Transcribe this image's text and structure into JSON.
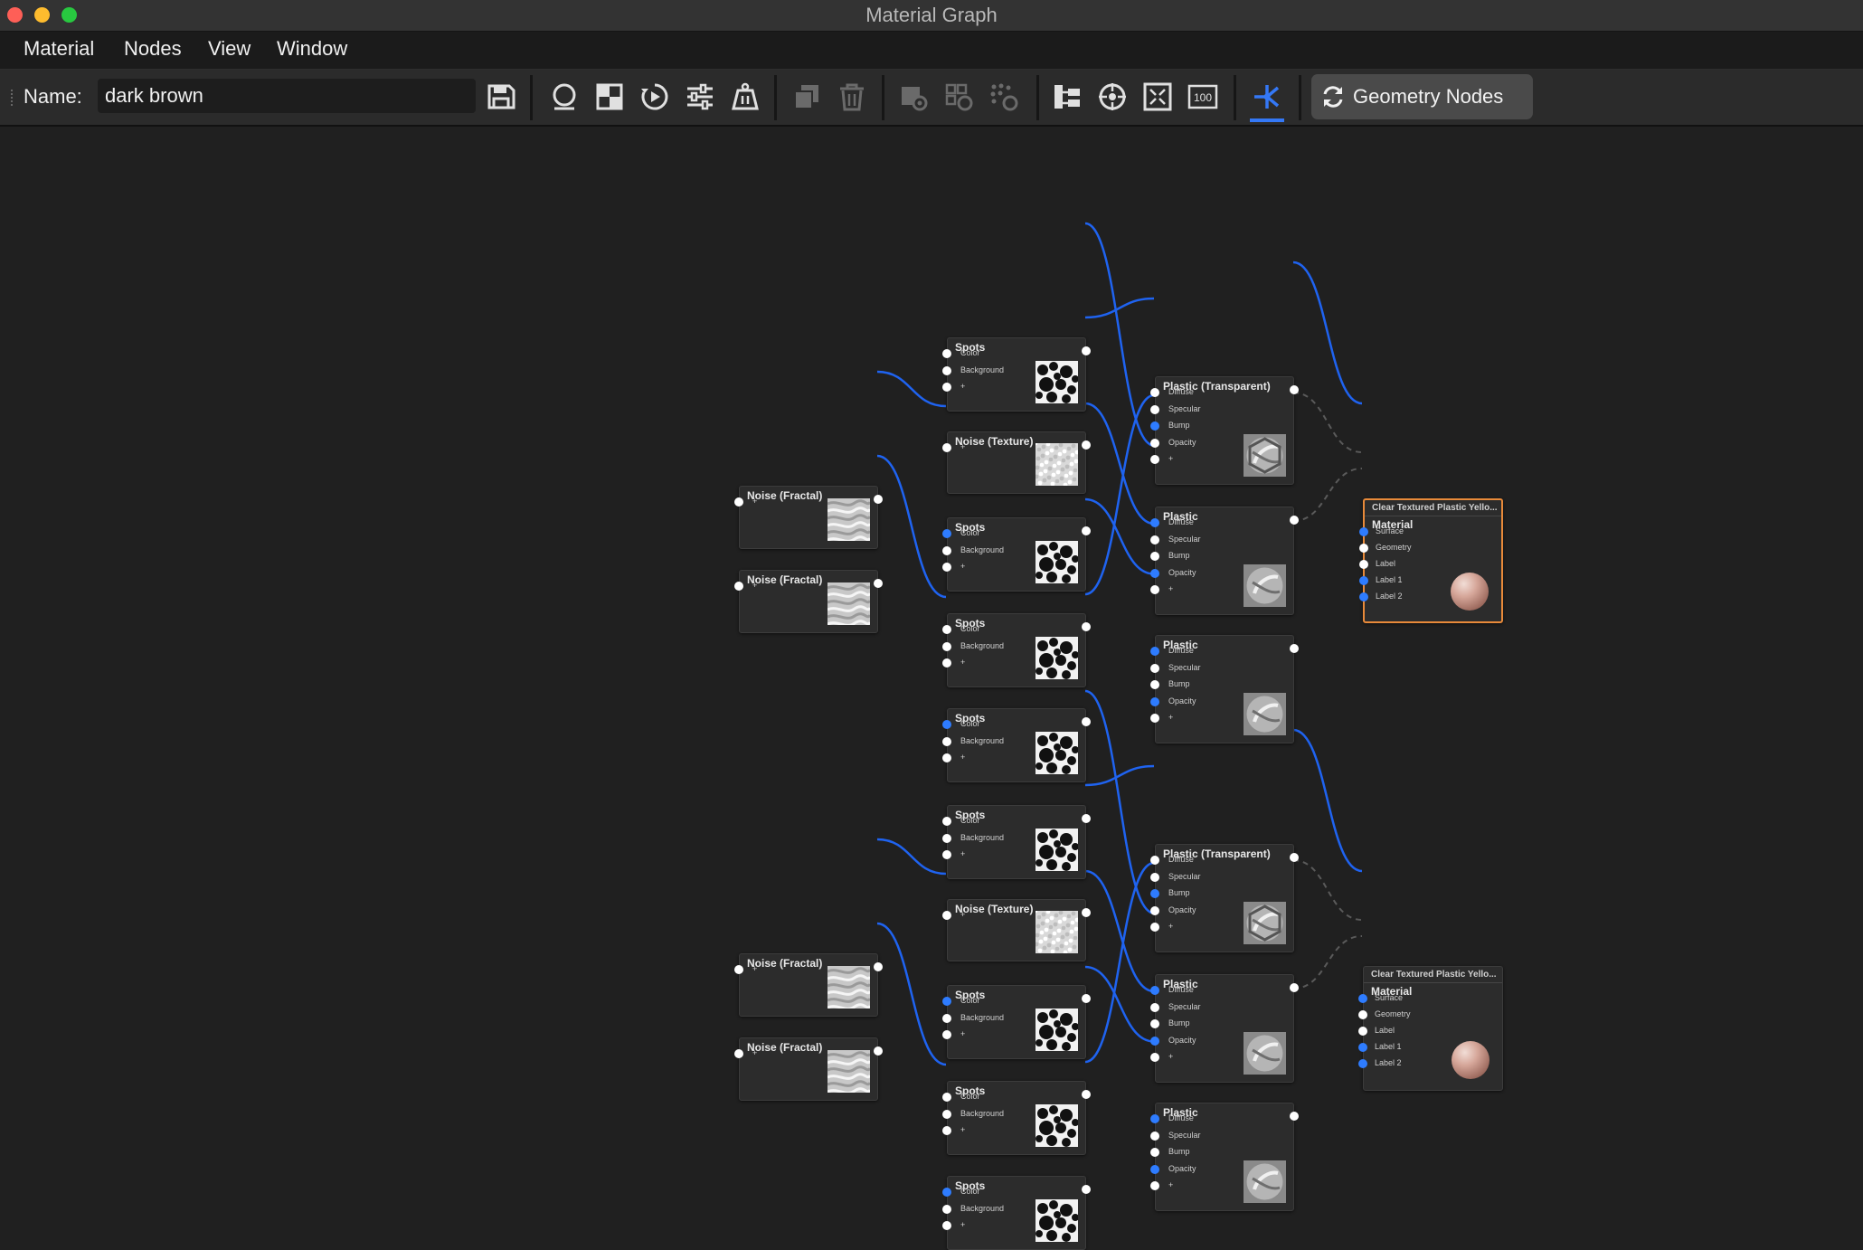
{
  "window": {
    "title": "Material Graph"
  },
  "menu": [
    "Material",
    "Nodes",
    "View",
    "Window"
  ],
  "toolbar": {
    "name_label": "Name:",
    "name_value": "dark brown",
    "geometry_button": "Geometry Nodes",
    "zoom_badge": "100"
  },
  "colors": {
    "accent": "#3478f6",
    "link": "#1f63f0",
    "selected_border": "#e88a3a",
    "canvas": "#202020"
  },
  "nodes": {
    "spots": {
      "title": "Spots",
      "ports": [
        "Color",
        "Background",
        "+"
      ]
    },
    "noise_texture": {
      "title": "Noise (Texture)",
      "ports": [
        "+"
      ]
    },
    "noise_fractal": {
      "title": "Noise (Fractal)",
      "ports": [
        "+"
      ]
    },
    "plastic_transparent": {
      "title": "Plastic (Transparent)",
      "ports": [
        "Diffuse",
        "Specular",
        "Bump",
        "Opacity",
        "+"
      ]
    },
    "plastic": {
      "title": "Plastic",
      "ports": [
        "Diffuse",
        "Specular",
        "Bump",
        "Opacity",
        "+"
      ]
    },
    "material": {
      "header": "Clear Textured Plastic Yello...",
      "title": "Material",
      "ports": [
        "Surface",
        "Geometry",
        "Label",
        "Label 1",
        "Label 2"
      ]
    }
  }
}
